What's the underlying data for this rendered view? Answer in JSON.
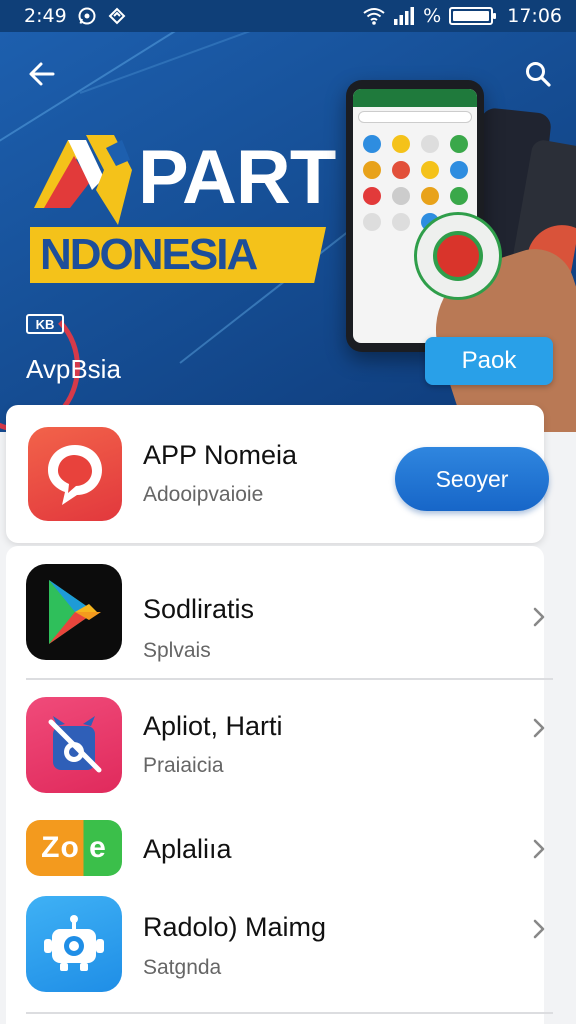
{
  "status_bar": {
    "time": "2:49",
    "right_time": "17:06",
    "percent_symbol": "%",
    "battery_level": 1.0,
    "icons": [
      "whatsapp-icon",
      "location-icon",
      "wifi-icon",
      "signal-icon",
      "battery-icon"
    ]
  },
  "hero": {
    "title": "PART",
    "banner": "NDONESIA",
    "chip": "KB",
    "subtitle": "AvpBsia",
    "action_label": "Paok",
    "icons": [
      "back-arrow-icon",
      "search-icon"
    ]
  },
  "featured": {
    "title": "APP Nomeia",
    "subtitle": "Adooipvaioie",
    "button_label": "Seoyer",
    "icon": "chat-bubble-icon"
  },
  "list": {
    "items": [
      {
        "title": "Sodliratis",
        "subtitle": "Splvais",
        "icon": "play-triangle-icon"
      },
      {
        "title": "Apliot, Harti",
        "subtitle": "Praiaicia",
        "icon": "robot-blocked-icon"
      },
      {
        "title": "Aplaliıa",
        "subtitle": "",
        "icon": "zoe-logo-icon",
        "icon_text": "Zo e"
      },
      {
        "title": "Radolo) Maimg",
        "subtitle": "Satgnda",
        "icon": "robot-icon"
      }
    ],
    "chevron_icon": "chevron-right-icon"
  },
  "colors": {
    "status_bg": "#0f3f78",
    "hero_bg": "#1a56a2",
    "banner_yellow": "#f4c21a",
    "accent_blue": "#1f76d2",
    "action_blue": "#29a0e8"
  }
}
